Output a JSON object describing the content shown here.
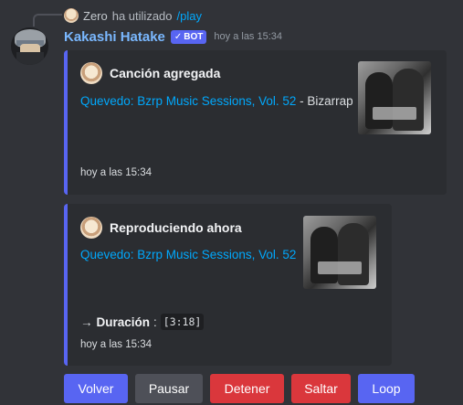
{
  "reply": {
    "user": "Zero",
    "text": "ha utilizado",
    "command": "/play"
  },
  "message": {
    "username": "Kakashi Hatake",
    "bot_badge": "BOT",
    "timestamp": "hoy a las 15:34"
  },
  "embed1": {
    "title": "Canción agregada",
    "link": "Quevedo: Bzrp Music Sessions, Vol. 52",
    "separator": "-",
    "artist": "Bizarrap",
    "footer": "hoy a las 15:34",
    "accent": "#5865f2"
  },
  "embed2": {
    "title": "Reproduciendo ahora",
    "link": "Quevedo: Bzrp Music Sessions, Vol. 52",
    "arrow": "→",
    "duration_label": "Duración",
    "colon": ":",
    "duration_value": "[3:18]",
    "footer": "hoy a las 15:34",
    "accent": "#5865f2"
  },
  "buttons": [
    {
      "label": "Volver",
      "style": "primary",
      "color": "#5865f2"
    },
    {
      "label": "Pausar",
      "style": "secondary",
      "color": "#4e5058"
    },
    {
      "label": "Detener",
      "style": "danger",
      "color": "#da373c"
    },
    {
      "label": "Saltar",
      "style": "danger",
      "color": "#da373c"
    },
    {
      "label": "Loop",
      "style": "primary",
      "color": "#5865f2"
    }
  ],
  "colors": {
    "background": "#313338",
    "embed_bg": "#2b2d31",
    "link": "#00a8fc",
    "username": "#7ab8ff"
  }
}
